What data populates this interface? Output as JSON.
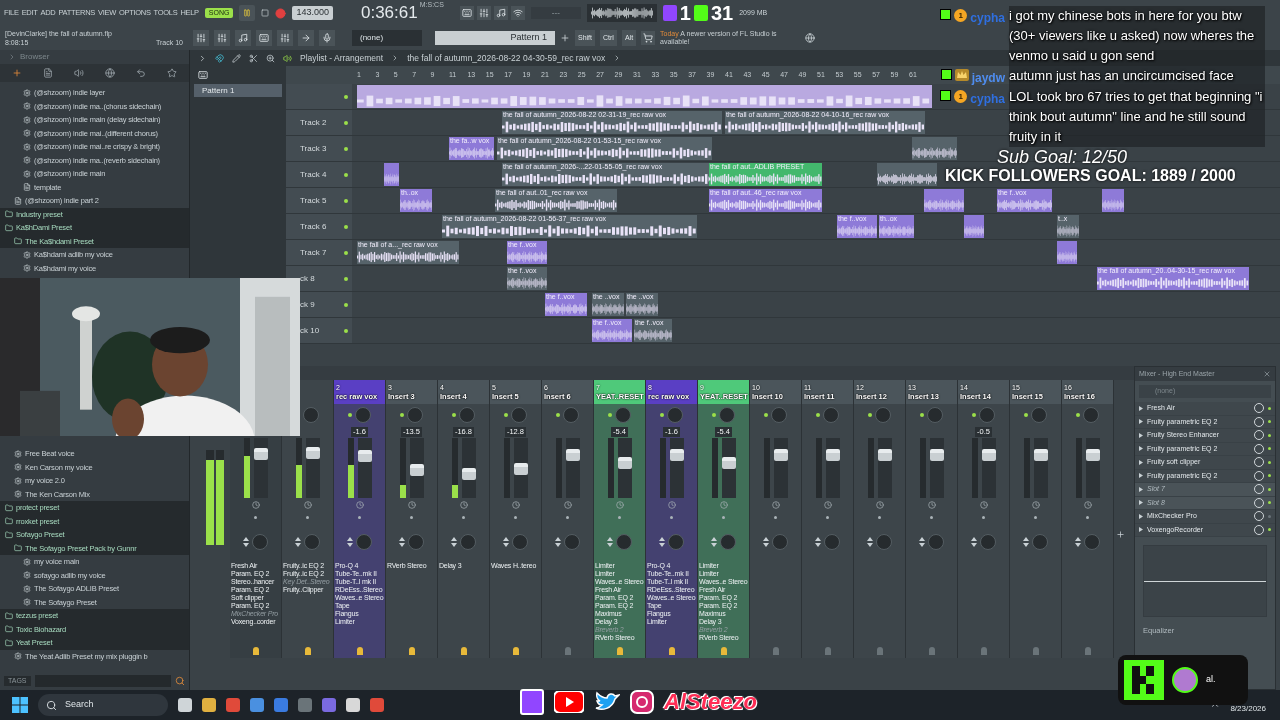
{
  "menu": [
    "FILE",
    "EDIT",
    "ADD",
    "PATTERNS",
    "VIEW",
    "OPTIONS",
    "TOOLS",
    "HELP"
  ],
  "transport": {
    "mode": {
      "label": "SONG",
      "selected": true
    },
    "playing": true,
    "tempo": "143.000",
    "time": "0:36:61",
    "time_unit": "M:S:CS",
    "hint": "---",
    "memory": "2099 MB"
  },
  "stream_counter": {
    "twitch": "1",
    "kick": "31"
  },
  "project": {
    "title": "[DevinClarke] the fall of autumn.flp",
    "time": "8:08:15",
    "track": "Track 10"
  },
  "toolbar": {
    "pattern_select": "(none)",
    "pattern": "Pattern 1",
    "keys": [
      "Shift",
      "Ctrl",
      "Alt"
    ],
    "news_day": "Today",
    "news": "A newer version of FL Studio is available!"
  },
  "browser": {
    "title": "Browser",
    "tags": "TAGS",
    "tree_top": [
      {
        "kind": "continued",
        "children": [
          {
            "kind": "continued",
            "children": [
              {
                "kind": "preset",
                "label": "(@shzoom) indie layer"
              },
              {
                "kind": "preset",
                "label": "(@shzoom) indie ma..(chorus sidechain)"
              },
              {
                "kind": "preset",
                "label": "(@shzoom) indie main (delay sidechain)"
              },
              {
                "kind": "preset",
                "label": "(@shzoom) indie mai..(different chorus)"
              },
              {
                "kind": "preset",
                "label": "(@shzoom) indie mai..re crispy & bright)"
              },
              {
                "kind": "preset",
                "label": "(@shzoom) indie ma..(reverb sidechain)"
              },
              {
                "kind": "preset",
                "label": "(@shzoom) indie main"
              },
              {
                "kind": "file",
                "label": "template"
              }
            ]
          },
          {
            "kind": "file",
            "label": "(@shzoom) indie part 2"
          }
        ]
      },
      {
        "kind": "folder",
        "label": "Industry preset"
      },
      {
        "kind": "folder",
        "label": "Ka$hDami Preset",
        "children": [
          {
            "kind": "folder",
            "label": "The Ka$hdami Preset",
            "children": [
              {
                "kind": "preset",
                "label": "Ka$hdami adlib my voice"
              },
              {
                "kind": "preset",
                "label": "Ka$hdami my voice"
              }
            ]
          }
        ]
      }
    ],
    "tree_bottom": [
      {
        "kind": "continued",
        "children": [
          {
            "kind": "preset",
            "label": "Free Beat voice"
          },
          {
            "kind": "preset",
            "label": "Ken Carson my voice"
          },
          {
            "kind": "preset",
            "label": "my voice 2.0"
          },
          {
            "kind": "preset",
            "label": "The Ken Carson Mix"
          }
        ]
      },
      {
        "kind": "folder",
        "label": "protect preset"
      },
      {
        "kind": "folder",
        "label": "rroxket preset"
      },
      {
        "kind": "folder",
        "label": "Sofaygo Preset",
        "children": [
          {
            "kind": "folder",
            "label": "The Sofaygo Preset Pack by Gunnr",
            "children": [
              {
                "kind": "preset",
                "label": "my voice main"
              },
              {
                "kind": "preset",
                "label": "sofaygo adlib my voice"
              },
              {
                "kind": "preset",
                "label": "The Sofaygo ADLIB Preset"
              },
              {
                "kind": "preset",
                "label": "The Sofaygo Preset"
              }
            ]
          }
        ]
      },
      {
        "kind": "folder",
        "label": "tezzus preset"
      },
      {
        "kind": "folder",
        "label": "Toxic Biohazard"
      },
      {
        "kind": "folder",
        "label": "Yeat Preset",
        "children": [
          {
            "kind": "preset",
            "label": "The Yeat Adlib Preset my mix pluggin b"
          }
        ]
      }
    ]
  },
  "playlist": {
    "title": "Playlist - Arrangement",
    "clip": "the fall of autumn_2026-08-22 04-30-59_rec raw vox",
    "patterns": [
      "Pattern 1"
    ],
    "ruler": [
      "1",
      "3",
      "5",
      "7",
      "9",
      "11",
      "13",
      "15",
      "17",
      "19",
      "21",
      "23",
      "25",
      "27",
      "29",
      "31",
      "33",
      "35",
      "37",
      "39",
      "41",
      "43",
      "45",
      "47",
      "49",
      "51",
      "53",
      "55",
      "57",
      "59",
      "61"
    ],
    "tracks": [
      {
        "clips": [
          {
            "color": "#b9a9e0"
          }
        ]
      },
      {
        "label": "Track 2",
        "clips": [
          {
            "label": "the fall of autumn_2026-08-22 02-31-19_rec raw vox",
            "color": "#56636a"
          },
          {
            "label": "the fall of autumn_2026-08-22 04-10-16_rec raw vox",
            "color": "#56636a"
          }
        ]
      },
      {
        "label": "Track 3",
        "clips": [
          {
            "label": "the fa..w vox",
            "color": "#8e7ad8"
          },
          {
            "label": "the fall of autumn_2026-08-22 01-53-15_rec raw vox",
            "color": "#56636a"
          },
          {
            "color": "#56636a"
          }
        ]
      },
      {
        "label": "Track 4",
        "clips": [
          {
            "color": "#8e7ad8"
          },
          {
            "label": "the fall of autumn_2026-...22-01-55-05_rec raw vox",
            "color": "#56636a"
          },
          {
            "label": "the fall of aut..ADLIB PRESET",
            "color": "#43b86d"
          },
          {
            "color": "#56636a"
          }
        ]
      },
      {
        "label": "Track 5",
        "clips": [
          {
            "label": "th..ox",
            "color": "#8e7ad8"
          },
          {
            "label": "the fall of aut..01_rec raw vox",
            "color": "#56636a"
          },
          {
            "label": "the fall of aut..46_rec raw vox",
            "color": "#8e7ad8"
          },
          {
            "color": "#8e7ad8"
          },
          {
            "label": "the f..vox",
            "color": "#8e7ad8"
          },
          {
            "color": "#8e7ad8"
          }
        ]
      },
      {
        "label": "Track 6",
        "clips": [
          {
            "label": "the fall of autumn_2026-08-22 01-56-37_rec raw vox",
            "color": "#56636a"
          },
          {
            "label": "the f..vox",
            "color": "#8e7ad8"
          },
          {
            "label": "th..ox",
            "color": "#8e7ad8"
          },
          {
            "color": "#8e7ad8"
          },
          {
            "label": "t..x",
            "color": "#56636a"
          }
        ]
      },
      {
        "label": "Track 7",
        "clips": [
          {
            "label": "the fall of a..._rec raw vox",
            "color": "#56636a"
          },
          {
            "label": "the f..vox",
            "color": "#8e7ad8"
          },
          {
            "color": "#8e7ad8"
          }
        ]
      },
      {
        "label": "ck 8",
        "clips": [
          {
            "label": "the f..vox",
            "color": "#56636a"
          },
          {
            "label": "the fall of autumn_20..04-30-15_rec raw vox",
            "color": "#8e7ad8"
          }
        ]
      },
      {
        "label": "ck 9",
        "clips": [
          {
            "label": "the f..vox",
            "color": "#8e7ad8"
          },
          {
            "label": "the ..vox",
            "color": "#56636a"
          },
          {
            "label": "the ..vox",
            "color": "#56636a"
          }
        ]
      },
      {
        "label": "ck 10",
        "clips": [
          {
            "label": "the f..vox",
            "color": "#8e7ad8"
          },
          {
            "label": "the f..vox",
            "color": "#56636a"
          }
        ]
      }
    ]
  },
  "mixer": {
    "master_meter": {
      "level": 0.9
    },
    "channels": [
      {
        "kind": "master",
        "fader": {
          "level": 0.8
        },
        "meter": {
          "level": 0.7
        },
        "routed": true,
        "plugins": [
          {
            "name": "Fresh Air",
            "disabled": false
          },
          {
            "name": "Param. EQ 2",
            "disabled": false
          },
          {
            "name": "Stereo..hancer",
            "disabled": false
          },
          {
            "name": "Param. EQ 2",
            "disabled": false
          },
          {
            "name": "Soft clipper",
            "disabled": false
          },
          {
            "name": "Param. EQ 2",
            "disabled": false
          },
          {
            "name": "MixChecker Pro",
            "disabled": true
          },
          {
            "name": "Voxeng..corder",
            "disabled": false
          }
        ]
      },
      {
        "kind": "insert",
        "fader": {
          "level": 0.82
        },
        "meter": {
          "level": 0.55
        },
        "routed": true,
        "plugins": [
          {
            "name": "Fruity..ic EQ 2",
            "disabled": false
          },
          {
            "name": "Fruity..ic EQ 2",
            "disabled": false
          },
          {
            "name": "Key Det..Stereo",
            "disabled": true
          },
          {
            "name": "Fruity..Clipper",
            "disabled": false
          }
        ]
      },
      {
        "kind": "insert",
        "number": "2",
        "name": "rec raw vox",
        "color": "#5a3fc4",
        "pan": "-1.6",
        "fader": {
          "level": 0.75
        },
        "meter": {
          "level": 0.55
        },
        "routed": true,
        "plugins": [
          {
            "name": "Pro-Q 4",
            "disabled": false
          },
          {
            "name": "Tube-Te..mk II",
            "disabled": false
          },
          {
            "name": "Tube-T..l mk II",
            "disabled": false
          },
          {
            "name": "RDeEss..Stereo",
            "disabled": false
          },
          {
            "name": "Waves..e Stereo",
            "disabled": false
          },
          {
            "name": "Tape",
            "disabled": false
          },
          {
            "name": "Flangus",
            "disabled": false
          },
          {
            "name": "Limiter",
            "disabled": false
          }
        ]
      },
      {
        "kind": "insert",
        "number": "3",
        "name": "Insert 3",
        "color": "#4b555b",
        "pan": "-13.5",
        "fader": {
          "level": 0.45
        },
        "meter": {
          "level": 0.22
        },
        "routed": true,
        "plugins": [
          {
            "name": "RVerb Stereo",
            "disabled": false
          }
        ]
      },
      {
        "kind": "insert",
        "number": "4",
        "name": "Insert 4",
        "color": "#4b555b",
        "pan": "-16.8",
        "fader": {
          "level": 0.38
        },
        "meter": {
          "level": 0.22
        },
        "routed": true,
        "plugins": [
          {
            "name": "Delay 3",
            "disabled": false
          }
        ]
      },
      {
        "kind": "insert",
        "number": "5",
        "name": "Insert 5",
        "color": "#4b555b",
        "pan": "-12.8",
        "fader": {
          "level": 0.48
        },
        "routed": true,
        "plugins": [
          {
            "name": "Waves H..tereo",
            "disabled": false
          }
        ]
      },
      {
        "kind": "insert",
        "number": "6",
        "name": "Insert 6",
        "color": "#4b555b",
        "fader": {
          "level": 0.78
        },
        "routed": false
      },
      {
        "kind": "insert",
        "number": "7",
        "name": "YEAT..RESET",
        "color": "#4fc97a",
        "pan": "-5.4",
        "fader": {
          "level": 0.6
        },
        "routed": true,
        "plugins": [
          {
            "name": "Limiter",
            "disabled": false
          },
          {
            "name": "Limiter",
            "disabled": false
          },
          {
            "name": "Waves..e Stereo",
            "disabled": false
          },
          {
            "name": "Fresh Air",
            "disabled": false
          },
          {
            "name": "Param. EQ 2",
            "disabled": false
          },
          {
            "name": "Param. EQ 2",
            "disabled": false
          },
          {
            "name": "Maximus",
            "disabled": false
          },
          {
            "name": "Delay 3",
            "disabled": false
          },
          {
            "name": "Breverb 2",
            "disabled": true
          },
          {
            "name": "RVerb Stereo",
            "disabled": false
          }
        ]
      },
      {
        "kind": "insert",
        "number": "8",
        "name": "rec raw vox",
        "color": "#5a3fc4",
        "pan": "-1.6",
        "fader": {
          "level": 0.78
        },
        "routed": true,
        "plugins": [
          {
            "name": "Pro-Q 4",
            "disabled": false
          },
          {
            "name": "Tube-Te..mk II",
            "disabled": false
          },
          {
            "name": "Tube-T..l mk II",
            "disabled": false
          },
          {
            "name": "RDeEss..Stereo",
            "disabled": false
          },
          {
            "name": "Waves..e Stereo",
            "disabled": false
          },
          {
            "name": "Tape",
            "disabled": false
          },
          {
            "name": "Flangus",
            "disabled": false
          },
          {
            "name": "Limiter",
            "disabled": false
          }
        ]
      },
      {
        "kind": "insert",
        "number": "9",
        "name": "YEAT..RESET",
        "color": "#4fc97a",
        "pan": "-5.4",
        "fader": {
          "level": 0.6
        },
        "routed": true,
        "plugins": [
          {
            "name": "Limiter",
            "disabled": false
          },
          {
            "name": "Limiter",
            "disabled": false
          },
          {
            "name": "Waves..e Stereo",
            "disabled": false
          },
          {
            "name": "Fresh Air",
            "disabled": false
          },
          {
            "name": "Param. EQ 2",
            "disabled": false
          },
          {
            "name": "Param. EQ 2",
            "disabled": false
          },
          {
            "name": "Maximus",
            "disabled": false
          },
          {
            "name": "Delay 3",
            "disabled": false
          },
          {
            "name": "Breverb 2",
            "disabled": true
          },
          {
            "name": "RVerb Stereo",
            "disabled": false
          }
        ]
      },
      {
        "kind": "insert",
        "number": "10",
        "name": "Insert 10",
        "color": "#4b555b",
        "fader": {
          "level": 0.78
        },
        "routed": false
      },
      {
        "kind": "insert",
        "number": "11",
        "name": "Insert 11",
        "color": "#4b555b",
        "fader": {
          "level": 0.78
        },
        "routed": false
      },
      {
        "kind": "insert",
        "number": "12",
        "name": "Insert 12",
        "color": "#4b555b",
        "fader": {
          "level": 0.78
        },
        "routed": false
      },
      {
        "kind": "insert",
        "number": "13",
        "name": "Insert 13",
        "color": "#4b555b",
        "fader": {
          "level": 0.78
        },
        "routed": false
      },
      {
        "kind": "insert",
        "number": "14",
        "name": "Insert 14",
        "color": "#4b555b",
        "pan": "-0.5",
        "fader": {
          "level": 0.78
        },
        "routed": false
      },
      {
        "kind": "insert",
        "number": "15",
        "name": "Insert 15",
        "color": "#4b555b",
        "fader": {
          "level": 0.78
        },
        "routed": false
      },
      {
        "kind": "insert",
        "number": "16",
        "name": "Insert 16",
        "color": "#4b555b",
        "fader": {
          "level": 0.78
        },
        "routed": false
      }
    ],
    "panel": {
      "title": "Mixer - High End Master",
      "preset": "(none)",
      "equalizer": "Equalizer",
      "slots": [
        {
          "name": "Fresh Air",
          "disabled": false,
          "on": true
        },
        {
          "name": "Fruity parametric EQ 2",
          "disabled": false,
          "on": true
        },
        {
          "name": "Fruity Stereo Enhancer",
          "disabled": false,
          "on": true
        },
        {
          "name": "Fruity parametric EQ 2",
          "disabled": false,
          "on": true
        },
        {
          "name": "Fruity soft clipper",
          "disabled": false,
          "on": true
        },
        {
          "name": "Fruity parametric EQ 2",
          "disabled": false,
          "on": true
        },
        {
          "name": "Slot 7",
          "disabled": true,
          "on": true
        },
        {
          "name": "Slot 8",
          "disabled": true,
          "on": true
        },
        {
          "name": "MixChecker Pro",
          "disabled": false,
          "on": false
        },
        {
          "name": "VoxengoRecorder",
          "disabled": false,
          "on": true
        }
      ]
    }
  },
  "chat": [
    {
      "user": "cypha",
      "color": "#2f6fe0",
      "badges": [
        {
          "kind": "platform"
        },
        {
          "kind": "coin",
          "text": "1"
        }
      ],
      "text": "i got my chinese bots in here for you btw (30+ viewers like u asked) now wheres the venmo u said u gon send"
    },
    {
      "user": "jaydw",
      "color": "#4f8df0",
      "badges": [
        {
          "kind": "platform"
        },
        {
          "kind": "crown"
        }
      ],
      "text": "autumn just has an uncircumcised face"
    },
    {
      "user": "cypha",
      "color": "#2f6fe0",
      "badges": [
        {
          "kind": "platform"
        },
        {
          "kind": "coin",
          "text": "1"
        }
      ],
      "text": "LOL took bro 67 tries to get that beginning \"i think bout autumn\" line and he still sound fruity in it"
    }
  ],
  "goals": {
    "sub": "Sub Goal: 12/50",
    "followers": "KICK FOLLOWERS GOAL: 1889 / 2000"
  },
  "social": {
    "handle": "AlSteezo"
  },
  "notification": {
    "name": "al."
  },
  "taskbar": {
    "search": "Search",
    "date": "8/23/2026"
  }
}
